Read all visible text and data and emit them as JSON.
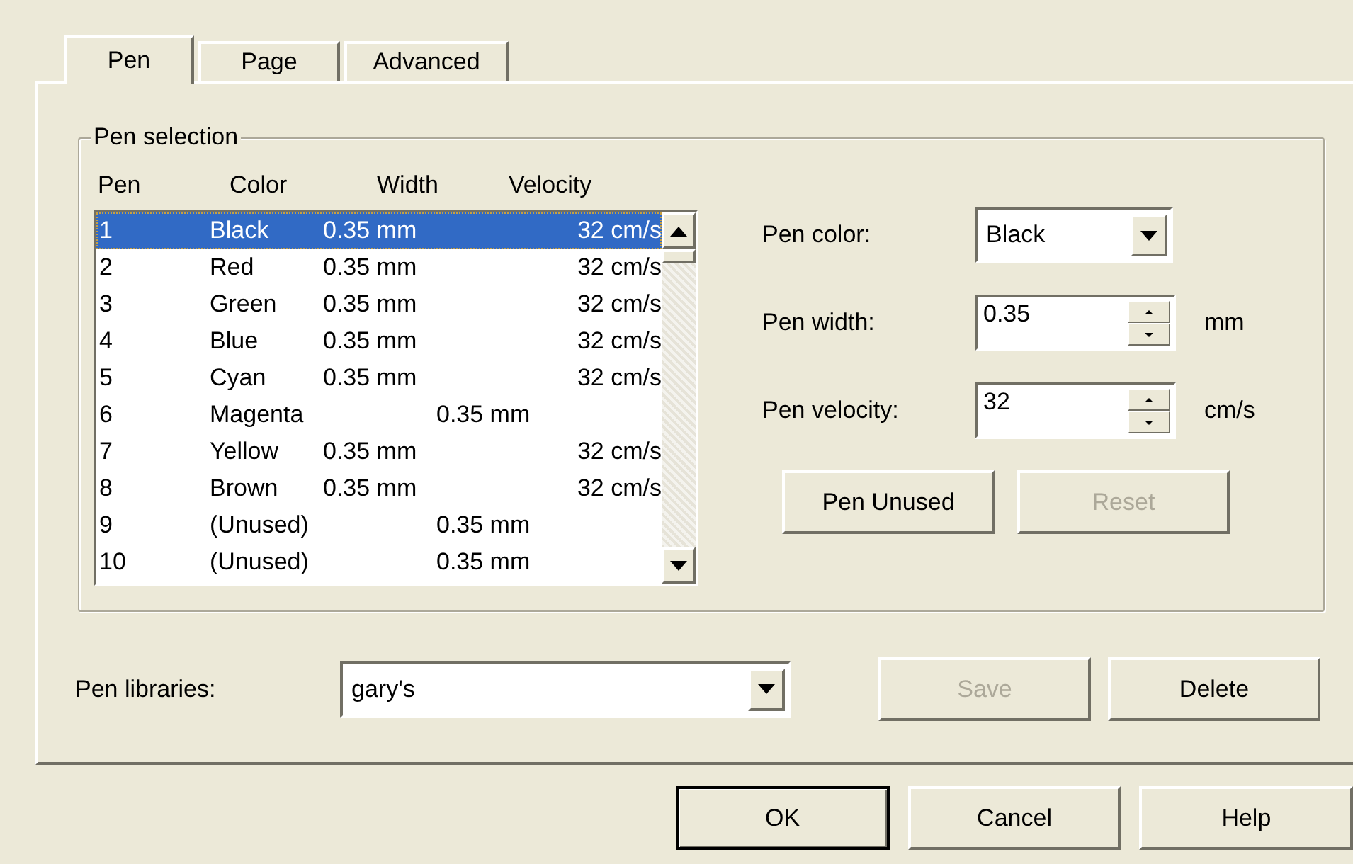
{
  "tabs": [
    {
      "label": "Pen",
      "selected": true
    },
    {
      "label": "Page",
      "selected": false
    },
    {
      "label": "Advanced",
      "selected": false
    }
  ],
  "pen_selection": {
    "title": "Pen selection",
    "columns": [
      "Pen",
      "Color",
      "Width",
      "Velocity"
    ],
    "rows": [
      {
        "pen": "1",
        "color_name": "Black",
        "width": "0.35 mm",
        "velocity": "32 cm/s",
        "selected": true,
        "kind": "normal"
      },
      {
        "pen": "2",
        "color_name": "Red",
        "width": "0.35 mm",
        "velocity": "32 cm/s",
        "selected": false,
        "kind": "normal"
      },
      {
        "pen": "3",
        "color_name": "Green",
        "width": "0.35 mm",
        "velocity": "32 cm/s",
        "selected": false,
        "kind": "normal"
      },
      {
        "pen": "4",
        "color_name": "Blue",
        "width": "0.35 mm",
        "velocity": "32 cm/s",
        "selected": false,
        "kind": "normal"
      },
      {
        "pen": "5",
        "color_name": "Cyan",
        "width": "0.35 mm",
        "velocity": "32 cm/s",
        "selected": false,
        "kind": "normal"
      },
      {
        "pen": "6",
        "color_name": "Magenta",
        "width": "0.35 mm",
        "selected": false,
        "kind": "shifted"
      },
      {
        "pen": "7",
        "color_name": "Yellow",
        "width": "0.35 mm",
        "velocity": "32 cm/s",
        "selected": false,
        "kind": "normal"
      },
      {
        "pen": "8",
        "color_name": "Brown",
        "width": "0.35 mm",
        "velocity": "32 cm/s",
        "selected": false,
        "kind": "normal"
      },
      {
        "pen": "9",
        "color_name": "(Unused)",
        "width": "0.35 mm",
        "selected": false,
        "kind": "shifted"
      },
      {
        "pen": "10",
        "color_name": "(Unused)",
        "width": "0.35 mm",
        "selected": false,
        "kind": "shifted"
      }
    ]
  },
  "pen_color": {
    "label": "Pen color:",
    "value": "Black"
  },
  "pen_width": {
    "label": "Pen width:",
    "value": "0.35",
    "unit": "mm"
  },
  "pen_velocity": {
    "label": "Pen velocity:",
    "value": "32",
    "unit": "cm/s"
  },
  "pen_buttons": [
    {
      "label": "Pen Unused",
      "disabled": false
    },
    {
      "label": "Reset",
      "disabled": true
    }
  ],
  "pen_libraries": {
    "label": "Pen libraries:",
    "value": "gary's"
  },
  "library_buttons": [
    {
      "label": "Save",
      "disabled": true
    },
    {
      "label": "Delete",
      "disabled": false
    }
  ],
  "dialog_buttons": [
    {
      "label": "OK",
      "default": true
    },
    {
      "label": "Cancel",
      "default": false
    },
    {
      "label": "Help",
      "default": false
    }
  ]
}
